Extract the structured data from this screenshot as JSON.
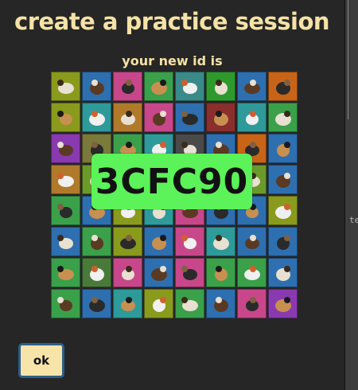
{
  "dialog": {
    "title": "create a practice session",
    "subtitle": "your new id is",
    "session_id": "3CFC90",
    "ok_label": "ok"
  },
  "background": {
    "peek_text": "te"
  },
  "colors": {
    "title": "#f5e2a6",
    "badge": "#5cf259",
    "button_bg": "#f7e4a9",
    "button_border": "#2c5f8a"
  },
  "animals": [
    {
      "name": "crocodile",
      "bg": "#8a9a1c"
    },
    {
      "name": "gazelle",
      "bg": "#2e6fb0"
    },
    {
      "name": "bat",
      "bg": "#c8478a"
    },
    {
      "name": "bear",
      "bg": "#3aa04a"
    },
    {
      "name": "bee",
      "bg": "#3a8a8a"
    },
    {
      "name": "beetle",
      "bg": "#2e9a2e"
    },
    {
      "name": "bison",
      "bg": "#2e6fb0"
    },
    {
      "name": "butterfly",
      "bg": "#c86418"
    },
    {
      "name": "bobcat",
      "bg": "#8a9a1c"
    },
    {
      "name": "crab",
      "bg": "#2e9a9a"
    },
    {
      "name": "deer",
      "bg": "#b07a2a"
    },
    {
      "name": "dolphin",
      "bg": "#c8478a"
    },
    {
      "name": "eagle",
      "bg": "#2e6fb0"
    },
    {
      "name": "elephant",
      "bg": "#8a2e2e"
    },
    {
      "name": "flamingo",
      "bg": "#2e9a9a"
    },
    {
      "name": "fox",
      "bg": "#3aa04a"
    },
    {
      "name": "frog",
      "bg": "#8a3ab0"
    },
    {
      "name": "goat",
      "bg": "#7a7a3a"
    },
    {
      "name": "gorilla",
      "bg": "#3aa04a"
    },
    {
      "name": "heron",
      "bg": "#2e9a9a"
    },
    {
      "name": "horse",
      "bg": "#4a4a4a"
    },
    {
      "name": "hummingbird",
      "bg": "#2e6fb0"
    },
    {
      "name": "jaguar",
      "bg": "#c86418"
    },
    {
      "name": "jellyfish",
      "bg": "#2e6fb0"
    },
    {
      "name": "kangaroo",
      "bg": "#b07a2a"
    },
    {
      "name": "leopard",
      "bg": "#6a9a2a"
    },
    {
      "name": "lion",
      "bg": "#2e6fb0"
    },
    {
      "name": "lizard",
      "bg": "#3aa04a"
    },
    {
      "name": "lobster",
      "bg": "#c83a3a"
    },
    {
      "name": "lynx",
      "bg": "#2e9a9a"
    },
    {
      "name": "moose",
      "bg": "#6a9a2a"
    },
    {
      "name": "moose2",
      "bg": "#2e6fb0"
    },
    {
      "name": "mouse",
      "bg": "#3aa04a"
    },
    {
      "name": "octopus",
      "bg": "#2e6fb0"
    },
    {
      "name": "owl",
      "bg": "#8a9a1c"
    },
    {
      "name": "panda",
      "bg": "#2e9a9a"
    },
    {
      "name": "cardinal",
      "bg": "#c8478a"
    },
    {
      "name": "parrot",
      "bg": "#2e6fb0"
    },
    {
      "name": "penguin",
      "bg": "#2e6fb0"
    },
    {
      "name": "pig",
      "bg": "#8a9a1c"
    },
    {
      "name": "puffin",
      "bg": "#2e6fb0"
    },
    {
      "name": "rabbit",
      "bg": "#3aa04a"
    },
    {
      "name": "raccoon",
      "bg": "#8a9a1c"
    },
    {
      "name": "manta-ray",
      "bg": "#2e6fb0"
    },
    {
      "name": "rhino",
      "bg": "#c8478a"
    },
    {
      "name": "salmon",
      "bg": "#2e9a9a"
    },
    {
      "name": "otter",
      "bg": "#2e6fb0"
    },
    {
      "name": "shark",
      "bg": "#2e6fb0"
    },
    {
      "name": "skunk",
      "bg": "#3aa04a"
    },
    {
      "name": "snake",
      "bg": "#4a7a3a"
    },
    {
      "name": "spider",
      "bg": "#c8478a"
    },
    {
      "name": "squid",
      "bg": "#2e6fb0"
    },
    {
      "name": "squirrel",
      "bg": "#c8478a"
    },
    {
      "name": "starfish",
      "bg": "#3aa04a"
    },
    {
      "name": "swan",
      "bg": "#3aa04a"
    },
    {
      "name": "tiger",
      "bg": "#2e6fb0"
    },
    {
      "name": "toucan",
      "bg": "#3aa04a"
    },
    {
      "name": "shark2",
      "bg": "#2e6fb0"
    },
    {
      "name": "turtle",
      "bg": "#2e9a9a"
    },
    {
      "name": "vulture",
      "bg": "#8a9a1c"
    },
    {
      "name": "walrus",
      "bg": "#3aa04a"
    },
    {
      "name": "whale",
      "bg": "#2e6fb0"
    },
    {
      "name": "wolf",
      "bg": "#c8478a"
    },
    {
      "name": "zebra",
      "bg": "#8a3ab0"
    }
  ]
}
